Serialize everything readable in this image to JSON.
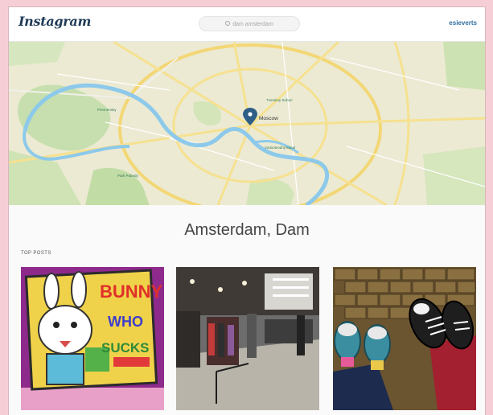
{
  "app": {
    "logo": "Instagram",
    "user": "esieverts"
  },
  "search": {
    "text": "dam amsterdam"
  },
  "map": {
    "labels": [
      "Moscow",
      "Tverskoy Suhuri",
      "Vodootvodny kanal",
      "Park Pobedy",
      "Presnensky"
    ]
  },
  "location": {
    "title": "Amsterdam, Dam"
  },
  "top_posts": {
    "label": "TOP POSTS",
    "posts": [
      {
        "text_art": [
          "BUNNY",
          "WHO",
          "SUCKS"
        ]
      },
      {
        "text_art": []
      },
      {
        "text_art": []
      }
    ]
  },
  "colors": {
    "link": "#2f6fa3",
    "map_river": "#8cc9ea",
    "map_road": "#f6e190"
  }
}
